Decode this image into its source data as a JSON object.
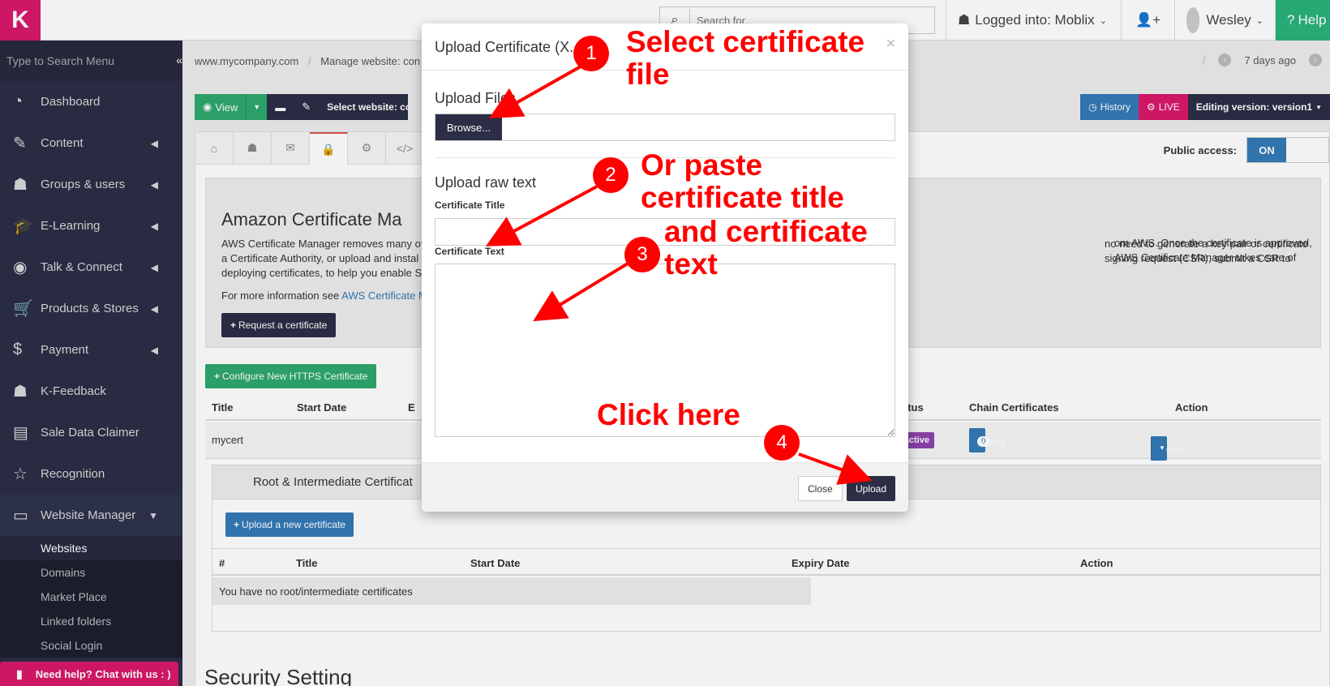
{
  "topbar": {
    "logo": "K",
    "search_placeholder": "Search for...",
    "logged_into": "Logged into: Moblix",
    "user": "Wesley",
    "help": "Help"
  },
  "sidebar": {
    "search_placeholder": "Type to Search Menu",
    "items": [
      {
        "label": "Dashboard",
        "icon": "dashboard-icon",
        "glyph": "◔"
      },
      {
        "label": "Content",
        "icon": "edit-icon",
        "glyph": "✎"
      },
      {
        "label": "Groups & users",
        "icon": "users-icon",
        "glyph": "☗"
      },
      {
        "label": "E-Learning",
        "icon": "graduation-cap-icon",
        "glyph": "🎓"
      },
      {
        "label": "Talk & Connect",
        "icon": "rss-icon",
        "glyph": "◉"
      },
      {
        "label": "Products & Stores",
        "icon": "cart-icon",
        "glyph": "🛒"
      },
      {
        "label": "Payment",
        "icon": "dollar-icon",
        "glyph": "$"
      },
      {
        "label": "K-Feedback",
        "icon": "users-icon",
        "glyph": "☗"
      },
      {
        "label": "Sale Data Claimer",
        "icon": "id-card-icon",
        "glyph": "▤"
      },
      {
        "label": "Recognition",
        "icon": "star-icon",
        "glyph": "☆"
      },
      {
        "label": "Website Manager",
        "icon": "desktop-icon",
        "glyph": "▭"
      }
    ],
    "sub_items": [
      "Websites",
      "Domains",
      "Market Place",
      "Linked folders",
      "Social Login"
    ],
    "chat": "Need help? Chat with us : )"
  },
  "main": {
    "breadcrumb": [
      "www.mycompany.com",
      "Manage website: con"
    ],
    "history_time": "7 days ago",
    "toolbar": {
      "view": "View",
      "select_website": "Select website: cons"
    },
    "right_toolbar": {
      "history": "History",
      "live": "LIVE",
      "editing": "Editing version: version1"
    },
    "public_access_label": "Public access:",
    "public_access_value": "ON",
    "jumbo": {
      "title": "Amazon Certificate Ma",
      "text_left": "AWS Certificate Manager removes many of",
      "text_left2": "a Certificate Authority, or upload and instal",
      "text_left3": "deploying certificates, to help you enable S",
      "text_right": "no need to generate a key pair or certificate signing request (CSR), submit a CSR to",
      "text_right2": "om AWS. Once the certificate is approved, AWS Certificate Manager takes care of",
      "more_prefix": "For more information see",
      "more_link": "AWS Certificate M",
      "request_btn": "Request a certificate"
    },
    "configure_btn": "Configure New HTTPS Certificate",
    "table": {
      "headers": [
        "Title",
        "Start Date",
        "E",
        "Status",
        "Chain Certificates",
        "Action"
      ],
      "row": {
        "title": "mycert",
        "status": "Inactive",
        "chain_count": "0",
        "chain_btn": "Modify",
        "action": "Menu"
      }
    },
    "root": {
      "title": "Root & Intermediate Certificat",
      "upload_btn": "Upload a new certificate",
      "headers": [
        "#",
        "Title",
        "Start Date",
        "Expiry Date",
        "Action"
      ],
      "empty": "You have no root/intermediate certificates"
    },
    "security_heading": "Security Setting"
  },
  "modal": {
    "title": "Upload Certificate (X.",
    "upload_files": "Upload Files",
    "browse": "Browse...",
    "upload_raw": "Upload raw text",
    "cert_title_label": "Certificate Title",
    "cert_text_label": "Certificate Text",
    "close": "Close",
    "upload": "Upload"
  },
  "annotations": {
    "a1_num": "1",
    "a1_text1": "Select certificate",
    "a1_text2": "file",
    "a2_num": "2",
    "a2_text1": "Or paste",
    "a2_text2": "certificate title",
    "a3_num": "3",
    "a3_text1": "and certificate",
    "a3_text2": "text",
    "a4_num": "4",
    "a4_text": "Click here",
    "color": "#ff0000"
  }
}
